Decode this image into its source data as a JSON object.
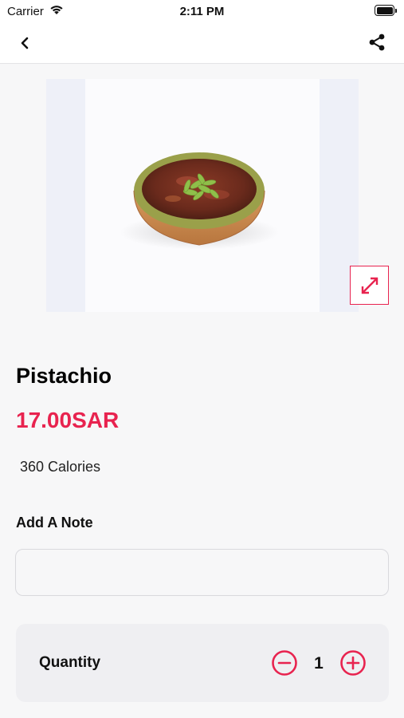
{
  "status_bar": {
    "carrier": "Carrier",
    "time": "2:11 PM"
  },
  "nav": {
    "back_icon": "chevron-left-icon",
    "share_icon": "share-icon"
  },
  "product": {
    "image_alt": "Pistachio tart",
    "expand_icon": "expand-icon",
    "name": "Pistachio",
    "price": "17.00SAR",
    "calories": "360 Calories"
  },
  "note": {
    "label": "Add A Note",
    "value": "",
    "placeholder": ""
  },
  "quantity": {
    "label": "Quantity",
    "value": "1",
    "minus_icon": "minus-circle-icon",
    "plus_icon": "plus-circle-icon"
  },
  "colors": {
    "accent": "#e8234f",
    "background": "#f7f7f8",
    "card": "#efeff2"
  }
}
